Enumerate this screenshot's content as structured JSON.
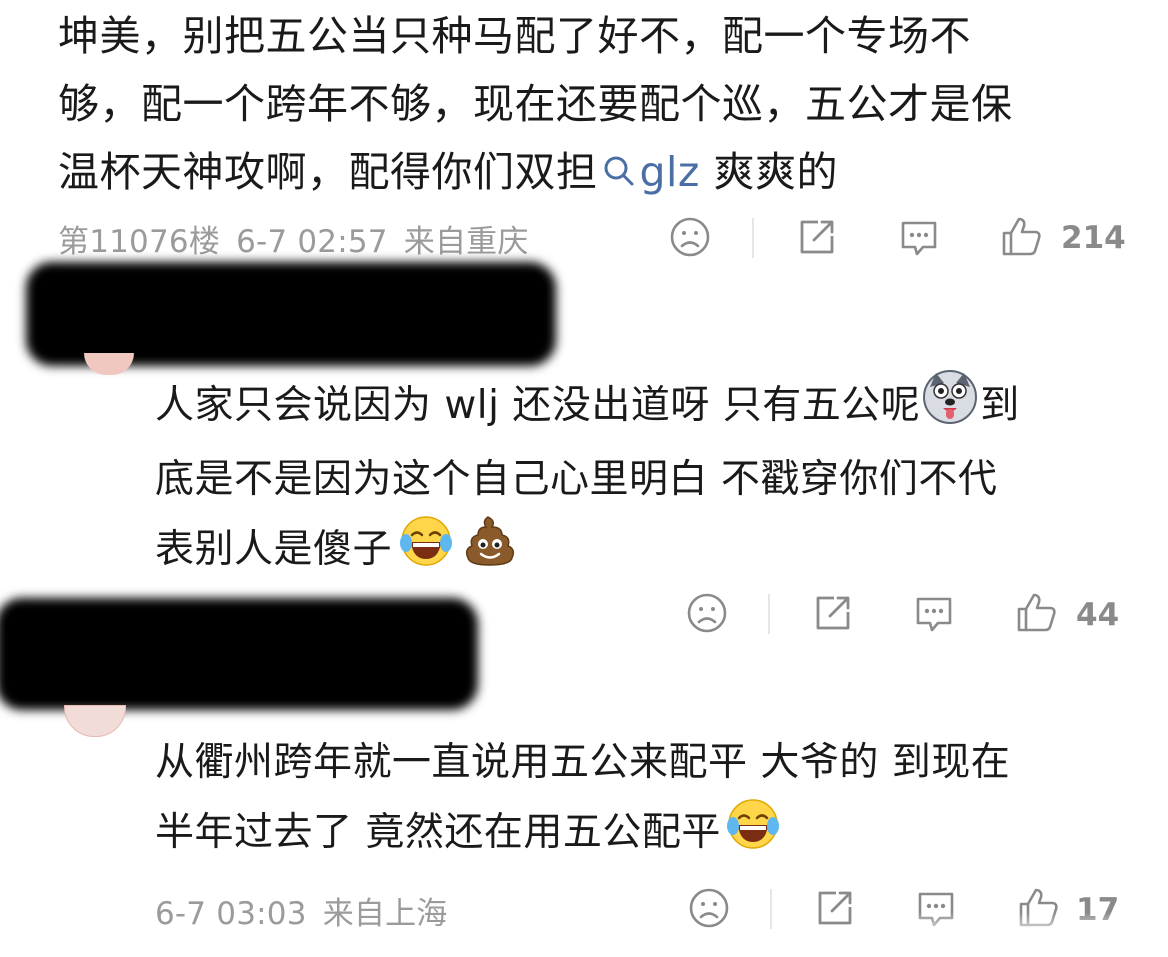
{
  "main_comment": {
    "line1": "坤美，别把五公当只种马配了好不，配一个专场不",
    "line2": "够，配一个跨年不够，现在还要配个巡，五公才是保",
    "line3_before": "温杯天神攻啊，配得你们双担",
    "topic": "glz",
    "line3_after": "爽爽的",
    "floor": "第11076楼",
    "time": "6-7 02:57",
    "location": "来自重庆",
    "likes": "214"
  },
  "reply1": {
    "line1": "人家只会说因为 wlj 还没出道呀 只有五公呢",
    "line1_end": "到",
    "line2": "底是不是因为这个自己心里明白 不戳穿你们不代",
    "line3": "表别人是傻子",
    "likes": "44"
  },
  "reply2": {
    "line1": "从衢州跨年就一直说用五公来配平 大爷的 到现在",
    "line2": "半年过去了 竟然还在用五公配平",
    "time": "6-7 03:03",
    "location": "来自上海",
    "likes": "17"
  },
  "icons": {
    "dislike": "frown-icon",
    "share": "share-icon",
    "comment": "comment-icon",
    "like": "thumbs-up-icon",
    "search": "search-icon",
    "husky_emoji": "dog-emoji-icon",
    "laugh_emoji": "tears-of-joy-icon",
    "poop_emoji": "poop-emoji-icon"
  },
  "colors": {
    "topic": "#4a6fa5",
    "meta": "#9b9b9b",
    "icon": "#8a8a8a"
  }
}
